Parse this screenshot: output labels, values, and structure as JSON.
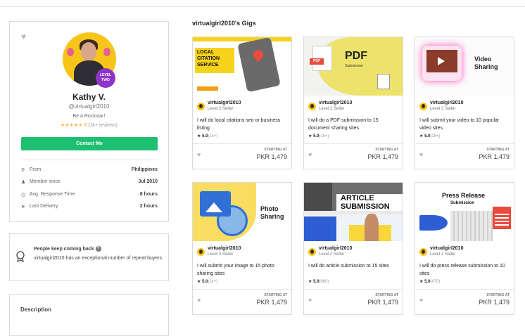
{
  "profile": {
    "name": "Kathy V.",
    "username": "@virtualgirl2010",
    "level_badge": "LEVEL TWO",
    "tagline": "Be a Rockstar!",
    "stars": "★★★★★",
    "rating": "5",
    "reviews": "(1k+ reviews)",
    "contact_label": "Contact Me",
    "stats": [
      {
        "icon": "location-pin-icon",
        "label": "From",
        "value": "Philippines"
      },
      {
        "icon": "user-icon",
        "label": "Member since",
        "value": "Jul 2010"
      },
      {
        "icon": "clock-icon",
        "label": "Avg. Response Time",
        "value": "8 hours"
      },
      {
        "icon": "paper-plane-icon",
        "label": "Last Delivery",
        "value": "2 hours"
      }
    ]
  },
  "repeat": {
    "title": "People keep coming back",
    "text": "virtualgirl2010 has an exceptional number of repeat buyers."
  },
  "description": {
    "title": "Description"
  },
  "gigs_title": "virtualgirl2010's Gigs",
  "gigs": [
    {
      "seller": "virtualgirl2010",
      "level": "Level 2 Seller",
      "title": "I will do local citations seo or business listing",
      "rating": "5.0",
      "count": "(1k+)",
      "starting": "STARTING AT",
      "price": "PKR 1,479",
      "thumb_text": [
        "LOCAL",
        "CITATION",
        "SERVICE"
      ]
    },
    {
      "seller": "virtualgirl2010",
      "level": "Level 2 Seller",
      "title": "I will do a PDF submission to 15 document sharing sites",
      "rating": "5.0",
      "count": "(1k+)",
      "starting": "STARTING AT",
      "price": "PKR 1,479",
      "thumb_text": [
        "PDF",
        "Submission"
      ]
    },
    {
      "seller": "virtualgirl2010",
      "level": "Level 2 Seller",
      "title": "I will submit your video to 10 popular video sites",
      "rating": "5.0",
      "count": "(1k+)",
      "starting": "STARTING AT",
      "price": "PKR 1,479",
      "thumb_text": [
        "Video",
        "Sharing"
      ]
    },
    {
      "seller": "virtualgirl2010",
      "level": "Level 2 Seller",
      "title": "I will submit your image to 15 photo sharing sites",
      "rating": "5.0",
      "count": "(1k+)",
      "starting": "STARTING AT",
      "price": "PKR 1,479",
      "thumb_text": [
        "Photo",
        "Sharing"
      ]
    },
    {
      "seller": "virtualgirl2010",
      "level": "Level 2 Seller",
      "title": "I will do article submission to 15 sites",
      "rating": "5.0",
      "count": "(960)",
      "starting": "STARTING AT",
      "price": "PKR 1,479",
      "thumb_text": [
        "ARTICLE",
        "SUBMISSION"
      ]
    },
    {
      "seller": "virtualgirl2010",
      "level": "Level 2 Seller",
      "title": "I will do press release submission to 10 sites",
      "rating": "5.0",
      "count": "(470)",
      "starting": "STARTING AT",
      "price": "PKR 1,479",
      "thumb_text": [
        "Press Release",
        "Submission"
      ]
    }
  ],
  "colors": {
    "accent": "#1dbf73",
    "star": "#ffb33e",
    "level_badge": "#8e35c9"
  }
}
